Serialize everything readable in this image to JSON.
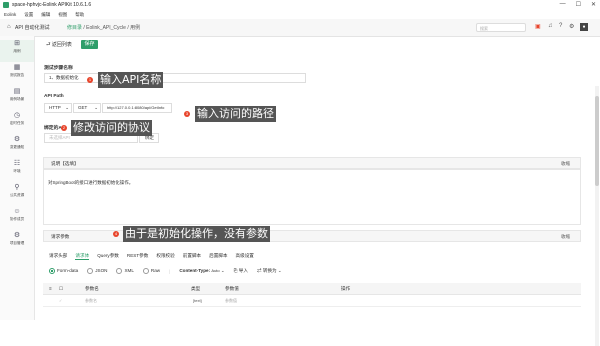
{
  "window": {
    "title": "space-hphvjc-Eolink APIKit 10.6.1.6",
    "controls": [
      "—",
      "☐",
      "✕"
    ]
  },
  "menu": [
    "Eolink",
    "设置",
    "编辑",
    "视图",
    "帮助"
  ],
  "topbar": {
    "app_name": "API 自动化测试",
    "breadcrumb_space": "修目录",
    "breadcrumb_rest": "/ Eolink_API_Cycle / 用例",
    "search_placeholder": "搜索"
  },
  "sidebar": [
    {
      "icon": "⊞",
      "label": "用例"
    },
    {
      "icon": "▦",
      "label": "测试报告"
    },
    {
      "icon": "▤",
      "label": "用例场景"
    },
    {
      "icon": "◷",
      "label": "定时任务"
    },
    {
      "icon": "⚙",
      "label": "变更通知"
    },
    {
      "icon": "☷",
      "label": "环境"
    },
    {
      "icon": "⚲",
      "label": "公共资源"
    },
    {
      "icon": "☺",
      "label": "协作成员"
    },
    {
      "icon": "⚙",
      "label": "项目管理"
    }
  ],
  "toolbar": {
    "back_label": "返回列表",
    "save_label": "保存"
  },
  "step_name": {
    "label": "测试步骤名称",
    "value": "1、数据初始化"
  },
  "api_path": {
    "label": "API Path",
    "protocol": "HTTP",
    "method": "GET",
    "url": "http://127.0.0.1:8080/api/GetInfo"
  },
  "bind": {
    "label": "绑定的API",
    "placeholder": "未选择API",
    "button": "绑定"
  },
  "description": {
    "title": "说明【选填】",
    "collapse": "收缩",
    "text": "对SpringBoot的接口进行数据初始化操作。"
  },
  "request": {
    "title": "请求参数",
    "collapse": "收缩",
    "tabs": [
      "请求头部",
      "请求体",
      "Query参数",
      "REST参数",
      "权限校验",
      "前置脚本",
      "后置脚本",
      "高级设置"
    ],
    "active_tab": "请求体",
    "body_types": [
      "Form-data",
      "JSON",
      "XML",
      "Raw"
    ],
    "active_body_type": "Form-data",
    "content_type_label": "Content-Type:",
    "content_type_value": "Auto",
    "import_label": "导入",
    "convert_label": "转换为",
    "columns": [
      "参数名",
      "类型",
      "参数值",
      "操作"
    ],
    "row": {
      "name": "参数名",
      "type": "[text]",
      "value": "参数值"
    }
  },
  "annotations": [
    {
      "num": "1",
      "text": "输入API名称"
    },
    {
      "num": "2",
      "text": "修改访问的协议"
    },
    {
      "num": "3",
      "text": "输入访问的路径"
    },
    {
      "num": "4",
      "text": "由于是初始化操作，没有参数"
    }
  ],
  "colors": {
    "accent": "#2f9e6a",
    "marker": "#e8452c",
    "annotation_bg": "#555555"
  }
}
